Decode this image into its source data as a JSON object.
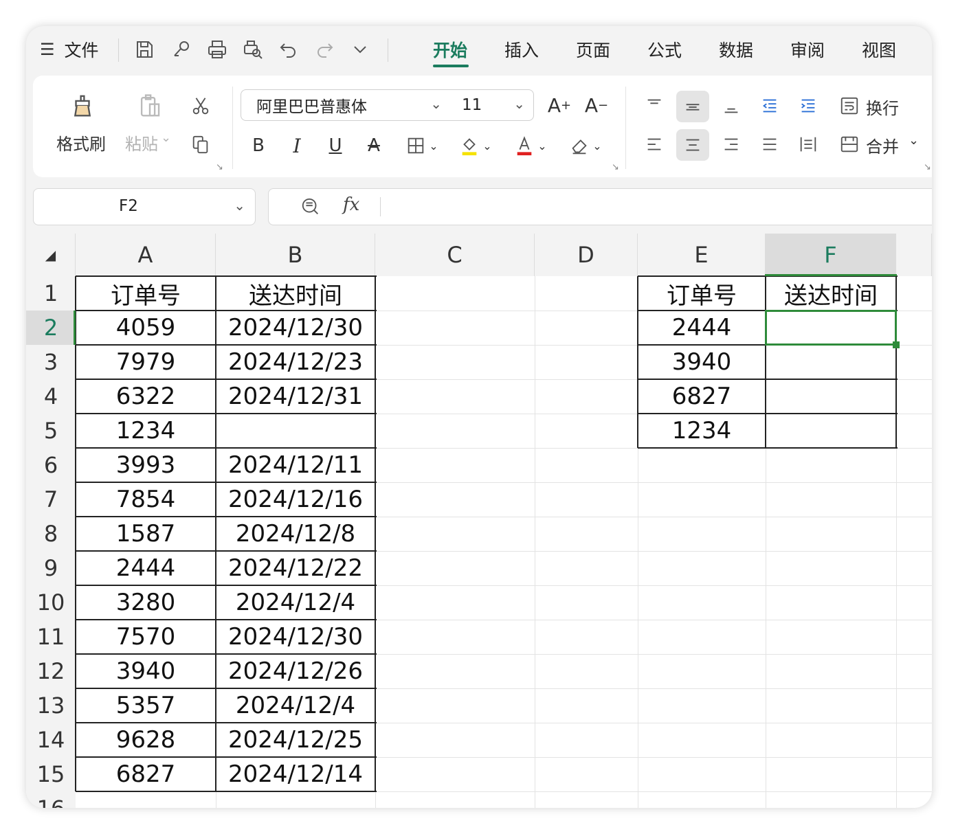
{
  "menubar": {
    "file_label": "文件",
    "tabs": [
      "开始",
      "插入",
      "页面",
      "公式",
      "数据",
      "审阅",
      "视图"
    ],
    "active_tab": "开始"
  },
  "ribbon": {
    "format_painter": "格式刷",
    "paste": "粘贴",
    "font_name": "阿里巴巴普惠体",
    "font_size": "11",
    "wrap": "换行",
    "merge": "合并"
  },
  "formula_bar": {
    "cell_ref": "F2",
    "fx_label": "fx",
    "content": ""
  },
  "sheet": {
    "columns": [
      "A",
      "B",
      "C",
      "D",
      "E",
      "F"
    ],
    "rows": [
      "1",
      "2",
      "3",
      "4",
      "5",
      "6",
      "7",
      "8",
      "9",
      "10",
      "11",
      "12",
      "13",
      "14",
      "15",
      "16"
    ],
    "selected_cell": "F2",
    "table1": {
      "headers": [
        "订单号",
        "送达时间"
      ],
      "rows": [
        [
          "4059",
          "2024/12/30"
        ],
        [
          "7979",
          "2024/12/23"
        ],
        [
          "6322",
          "2024/12/31"
        ],
        [
          "1234",
          ""
        ],
        [
          "3993",
          "2024/12/11"
        ],
        [
          "7854",
          "2024/12/16"
        ],
        [
          "1587",
          "2024/12/8"
        ],
        [
          "2444",
          "2024/12/22"
        ],
        [
          "3280",
          "2024/12/4"
        ],
        [
          "7570",
          "2024/12/30"
        ],
        [
          "3940",
          "2024/12/26"
        ],
        [
          "5357",
          "2024/12/4"
        ],
        [
          "9628",
          "2024/12/25"
        ],
        [
          "6827",
          "2024/12/14"
        ]
      ]
    },
    "table2": {
      "headers": [
        "订单号",
        "送达时间"
      ],
      "rows": [
        [
          "2444",
          ""
        ],
        [
          "3940",
          ""
        ],
        [
          "6827",
          ""
        ],
        [
          "1234",
          ""
        ]
      ]
    }
  },
  "colors": {
    "accent": "#1b7c5e",
    "selection": "#2e8b3a",
    "highlight_yellow": "#f5e200",
    "font_red": "#e02020"
  }
}
